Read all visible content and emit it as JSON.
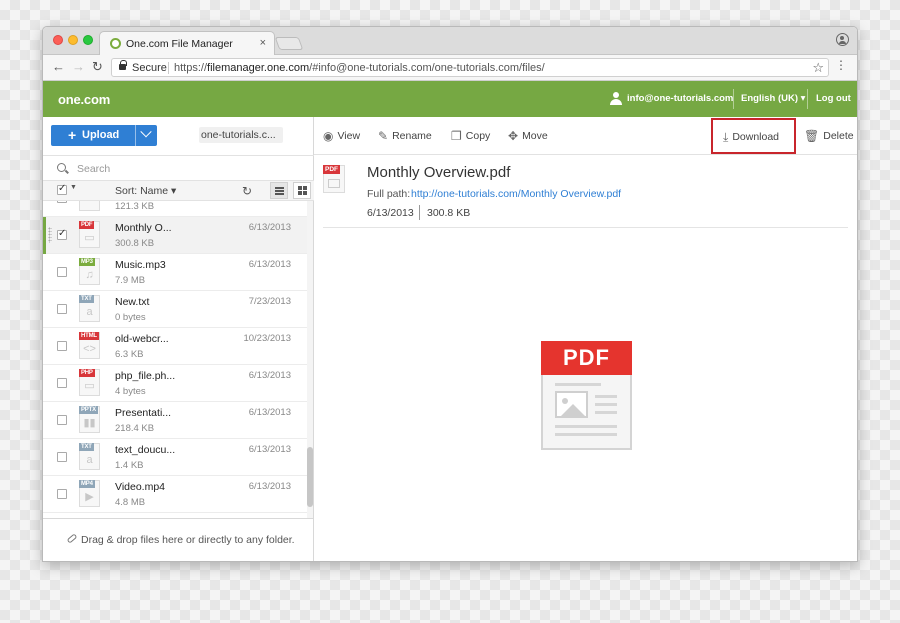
{
  "browser": {
    "tab_title": "One.com File Manager",
    "tab_close": "×",
    "secure_label": "Secure",
    "url_scheme": "https://",
    "url_host": "filemanager.one.com",
    "url_path": "/#info@one-tutorials.com/one-tutorials.com/files/"
  },
  "app": {
    "brand": "one.com",
    "user_email": "info@one-tutorials.com",
    "language": "English (UK) ▾",
    "logout": "Log out"
  },
  "sidebar": {
    "upload_label": "Upload",
    "breadcrumb": "one-tutorials.c...",
    "search_placeholder": "Search",
    "sort_label": "Sort: Name ▾",
    "drop_text": "Drag & drop files here or directly to any folder."
  },
  "files": [
    {
      "name": "",
      "size": "121.3 KB",
      "date": "",
      "tag": "",
      "tag_color": "#999999",
      "glyph": "",
      "checked": false,
      "selected": false
    },
    {
      "name": "Monthly O...",
      "size": "300.8 KB",
      "date": "6/13/2013",
      "tag": "PDF",
      "tag_color": "#d8363a",
      "glyph": "▭",
      "checked": true,
      "selected": true
    },
    {
      "name": "Music.mp3",
      "size": "7.9 MB",
      "date": "6/13/2013",
      "tag": "MP3",
      "tag_color": "#7bac3e",
      "glyph": "♫",
      "checked": false,
      "selected": false
    },
    {
      "name": "New.txt",
      "size": "0 bytes",
      "date": "7/23/2013",
      "tag": "TXT",
      "tag_color": "#8fa6b8",
      "glyph": "a",
      "checked": false,
      "selected": false
    },
    {
      "name": "old-webcr...",
      "size": "6.3 KB",
      "date": "10/23/2013",
      "tag": "HTML",
      "tag_color": "#d8363a",
      "glyph": "<>",
      "checked": false,
      "selected": false
    },
    {
      "name": "php_file.ph...",
      "size": "4 bytes",
      "date": "6/13/2013",
      "tag": "PHP",
      "tag_color": "#d8363a",
      "glyph": "▭",
      "checked": false,
      "selected": false
    },
    {
      "name": "Presentati...",
      "size": "218.4 KB",
      "date": "6/13/2013",
      "tag": "PPTX",
      "tag_color": "#8fa6b8",
      "glyph": "▮▮",
      "checked": false,
      "selected": false
    },
    {
      "name": "text_doucu...",
      "size": "1.4 KB",
      "date": "6/13/2013",
      "tag": "TXT",
      "tag_color": "#8fa6b8",
      "glyph": "a",
      "checked": false,
      "selected": false
    },
    {
      "name": "Video.mp4",
      "size": "4.8 MB",
      "date": "6/13/2013",
      "tag": "MP4",
      "tag_color": "#8fa6b8",
      "glyph": "▶",
      "checked": false,
      "selected": false
    }
  ],
  "toolbar": {
    "view": "View",
    "rename": "Rename",
    "copy": "Copy",
    "move": "Move",
    "download": "Download",
    "delete": "Delete"
  },
  "detail": {
    "icon_tag": "PDF",
    "title": "Monthly Overview.pdf",
    "path_label": "Full path:",
    "path": "http://one-tutorials.com/Monthly Overview.pdf",
    "date": "6/13/2013",
    "size": "300.8 KB",
    "preview_label": "PDF"
  },
  "colors": {
    "brand_green": "#76a843",
    "upload_blue": "#2f7fd4",
    "highlight_red": "#c8252c",
    "pdf_red": "#e5342e"
  }
}
